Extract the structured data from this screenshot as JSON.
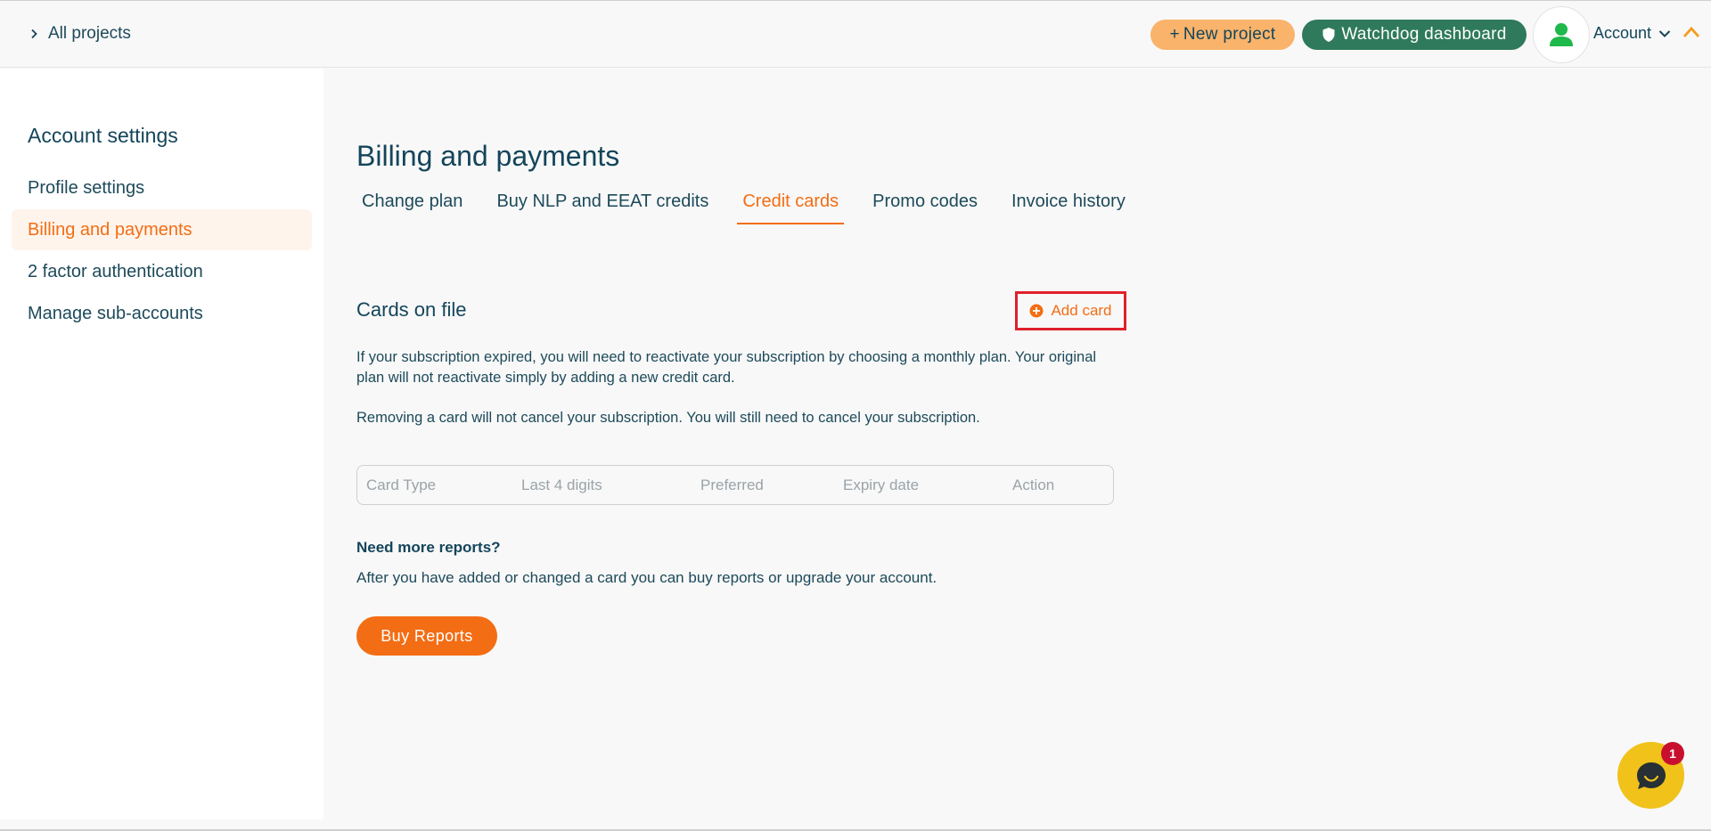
{
  "header": {
    "breadcrumb_label": "All projects",
    "new_project_label": "New project",
    "new_project_plus": "+",
    "watchdog_label": "Watchdog dashboard",
    "account_label": "Account"
  },
  "sidebar": {
    "title": "Account settings",
    "items": [
      {
        "label": "Profile settings",
        "active": false
      },
      {
        "label": "Billing and payments",
        "active": true
      },
      {
        "label": "2 factor authentication",
        "active": false
      },
      {
        "label": "Manage sub-accounts",
        "active": false
      }
    ]
  },
  "main": {
    "title": "Billing and payments",
    "tabs": [
      {
        "label": "Change plan",
        "active": false
      },
      {
        "label": "Buy NLP and EEAT credits",
        "active": false
      },
      {
        "label": "Credit cards",
        "active": true
      },
      {
        "label": "Promo codes",
        "active": false
      },
      {
        "label": "Invoice history",
        "active": false
      }
    ],
    "cards_section": {
      "title": "Cards on file",
      "add_card_label": "Add card",
      "info_1": "If your subscription expired, you will need to reactivate your subscription by choosing a monthly plan. Your original plan will not reactivate simply by adding a new credit card.",
      "info_2": "Removing a card will not cancel your subscription. You will still need to cancel your subscription.",
      "table_headers": [
        "Card Type",
        "Last 4 digits",
        "Preferred",
        "Expiry date",
        "Action"
      ]
    },
    "reports": {
      "title": "Need more reports?",
      "text": "After you have added or changed a card you can buy reports or upgrade your account.",
      "button_label": "Buy Reports"
    }
  },
  "chat": {
    "badge_count": "1"
  },
  "colors": {
    "accent": "#f36d14",
    "primary_text": "#14455a",
    "watchdog_green": "#2f7a5c",
    "new_project_bg": "#f9b36b",
    "chat_yellow": "#f0c21a",
    "highlight_red": "#e0202a"
  }
}
